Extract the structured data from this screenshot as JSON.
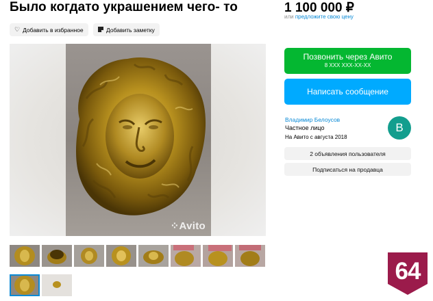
{
  "listing": {
    "title": "Было когдато украшением чего- то",
    "price": "1 100 000 ₽",
    "offer_prefix": "или ",
    "offer_link": "предложите свою цену"
  },
  "actions": {
    "favorite_label": "Добавить в избранное",
    "note_label": "Добавить заметку"
  },
  "gallery": {
    "watermark": "Avito",
    "thumbnail_count": 10,
    "active_thumbnail": 9
  },
  "contact": {
    "call_label": "Позвонить через Авито",
    "call_number": "8 XXX XXX-XX-XX",
    "message_label": "Написать сообщение"
  },
  "seller": {
    "name": "Владимир Белоусов",
    "type": "Частное лицо",
    "since": "На Авито с августа 2018",
    "avatar_letter": "В",
    "ads_label": "2 объявления пользователя",
    "subscribe_label": "Подписаться на продавца"
  },
  "overlay": {
    "badge_text": "64"
  },
  "colors": {
    "green": "#04b731",
    "blue": "#00aaff",
    "link": "#0a8ad6",
    "avatar": "#139e8e",
    "badge": "#9b1b4b"
  }
}
